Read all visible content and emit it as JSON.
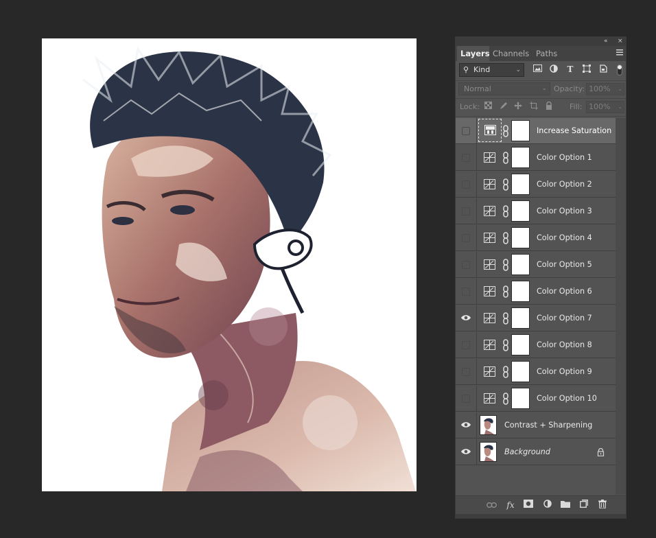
{
  "panel": {
    "collapse_glyph": "«",
    "close_glyph": "×",
    "tabs": [
      {
        "label": "Layers",
        "active": true
      },
      {
        "label": "Channels",
        "active": false
      },
      {
        "label": "Paths",
        "active": false
      }
    ],
    "menu_icon": "panel-menu-icon"
  },
  "filter": {
    "kind_label": "Kind",
    "filter_icons": [
      "pixel-filter-icon",
      "adjustment-filter-icon",
      "type-filter-icon",
      "shape-filter-icon",
      "smart-object-filter-icon"
    ],
    "type_glyph": "T"
  },
  "blending": {
    "mode": "Normal",
    "opacity_label": "Opacity:",
    "opacity_value": "100%",
    "fill_label": "Fill:",
    "fill_value": "100%"
  },
  "lock": {
    "label": "Lock:",
    "icons": [
      "lock-transparent-icon",
      "lock-image-icon",
      "lock-position-icon",
      "lock-artboard-icon",
      "lock-all-icon"
    ]
  },
  "layers": [
    {
      "name": "Increase Saturation",
      "type": "adjustment",
      "visible": false,
      "selected": true
    },
    {
      "name": "Color Option 1",
      "type": "adjustment",
      "visible": false,
      "selected": false
    },
    {
      "name": "Color Option 2",
      "type": "adjustment",
      "visible": false,
      "selected": false
    },
    {
      "name": "Color Option 3",
      "type": "adjustment",
      "visible": false,
      "selected": false
    },
    {
      "name": "Color Option 4",
      "type": "adjustment",
      "visible": false,
      "selected": false
    },
    {
      "name": "Color Option 5",
      "type": "adjustment",
      "visible": false,
      "selected": false
    },
    {
      "name": "Color Option 6",
      "type": "adjustment",
      "visible": false,
      "selected": false
    },
    {
      "name": "Color Option 7",
      "type": "adjustment",
      "visible": true,
      "selected": false
    },
    {
      "name": "Color Option 8",
      "type": "adjustment",
      "visible": false,
      "selected": false
    },
    {
      "name": "Color Option 9",
      "type": "adjustment",
      "visible": false,
      "selected": false
    },
    {
      "name": "Color Option 10",
      "type": "adjustment",
      "visible": false,
      "selected": false
    },
    {
      "name": "Contrast + Sharpening",
      "type": "image",
      "visible": true,
      "selected": false
    },
    {
      "name": "Background",
      "type": "image",
      "visible": true,
      "selected": false,
      "locked": true,
      "italic": true
    }
  ],
  "bottom_bar": {
    "icons": [
      "link-layers-icon",
      "layer-style-icon",
      "add-mask-icon",
      "adjustment-layer-icon",
      "new-group-icon",
      "new-layer-icon",
      "delete-layer-icon"
    ],
    "fx_label": "fx"
  },
  "colors": {
    "app_background": "#282828",
    "panel_background": "#535353",
    "selected_layer": "#686868",
    "canvas": "#ffffff"
  }
}
